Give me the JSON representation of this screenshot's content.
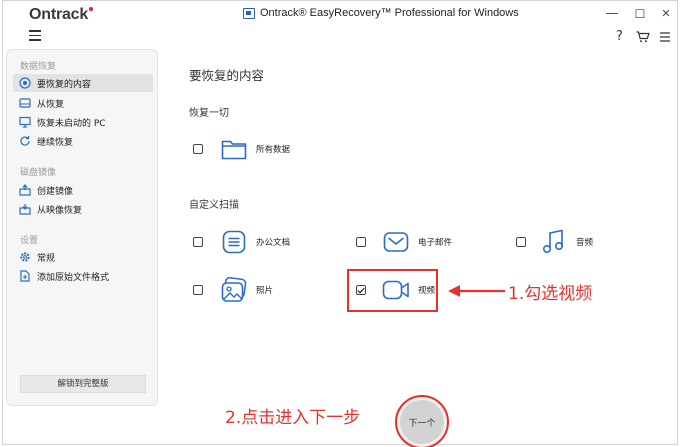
{
  "window": {
    "logo": "Ontrack",
    "title": "Ontrack® EasyRecovery™ Professional for Windows",
    "controls": {
      "minimize": "—",
      "maximize": "☐",
      "close": "✕"
    }
  },
  "toolbar": {
    "help": "?"
  },
  "sidebar": {
    "sections": [
      {
        "label": "数据恢复"
      },
      {
        "label": "磁盘镜像"
      },
      {
        "label": "设置"
      }
    ],
    "items": [
      {
        "label": "要恢复的内容",
        "icon": "target-icon",
        "active": true
      },
      {
        "label": "从恢复",
        "icon": "drive-icon"
      },
      {
        "label": "恢复未启动的 PC",
        "icon": "monitor-icon"
      },
      {
        "label": "继续恢复",
        "icon": "refresh-icon"
      },
      {
        "label": "创建镜像",
        "icon": "create-image-icon"
      },
      {
        "label": "从映像恢复",
        "icon": "restore-image-icon"
      },
      {
        "label": "常规",
        "icon": "gear-icon"
      },
      {
        "label": "添加原始文件格式",
        "icon": "add-file-icon"
      }
    ],
    "unlock_label": "解锁到完整版"
  },
  "main": {
    "title": "要恢复的内容",
    "recover_all": {
      "label": "恢复一切",
      "options": [
        {
          "label": "所有数据",
          "icon": "folder-icon",
          "checked": false
        }
      ]
    },
    "custom_scan": {
      "label": "自定义扫描",
      "options": [
        {
          "label": "办公文档",
          "icon": "document-icon",
          "checked": false
        },
        {
          "label": "电子邮件",
          "icon": "email-icon",
          "checked": false
        },
        {
          "label": "音频",
          "icon": "music-icon",
          "checked": false
        },
        {
          "label": "照片",
          "icon": "photo-icon",
          "checked": false
        },
        {
          "label": "视频",
          "icon": "video-icon",
          "checked": true
        }
      ]
    },
    "next_label": "下一个"
  },
  "annotations": {
    "step1": "1.勾选视频",
    "step2": "2.点击进入下一步",
    "color": "#e5322d"
  },
  "colors": {
    "icon_blue": "#2b6cc4",
    "accent_red": "#e5322d"
  }
}
